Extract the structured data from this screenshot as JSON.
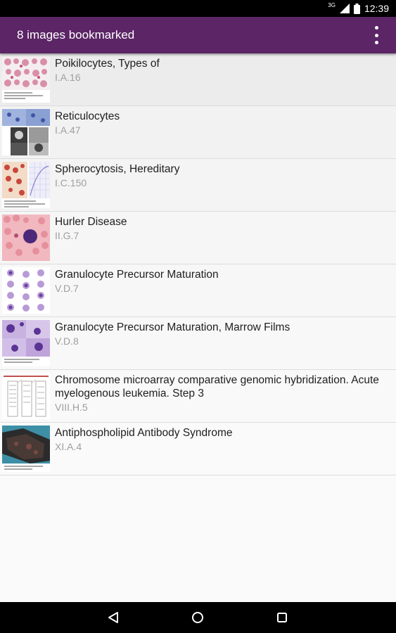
{
  "status_bar": {
    "network_label": "3G",
    "time": "12:39",
    "icons": [
      "signal-icon",
      "battery-icon"
    ]
  },
  "app_bar": {
    "title": "8 images bookmarked",
    "overflow_icon": "more-vertical-icon",
    "color": "#5b2566"
  },
  "bookmarks": [
    {
      "title": "Poikilocytes, Types of",
      "code": "I.A.16"
    },
    {
      "title": "Reticulocytes",
      "code": "I.A.47"
    },
    {
      "title": "Spherocytosis, Hereditary",
      "code": "I.C.150"
    },
    {
      "title": "Hurler Disease",
      "code": "II.G.7"
    },
    {
      "title": "Granulocyte Precursor Maturation",
      "code": "V.D.7"
    },
    {
      "title": "Granulocyte Precursor Maturation, Marrow Films",
      "code": "V.D.8"
    },
    {
      "title": "Chromosome microarray comparative genomic hybridization. Acute myelogenous leukemia. Step 3",
      "code": "VIII.H.5"
    },
    {
      "title": "Antiphospholipid Antibody Syndrome",
      "code": "XI.A.4"
    }
  ],
  "nav_bar": {
    "icons": [
      "back-icon",
      "home-icon",
      "recents-icon"
    ]
  }
}
